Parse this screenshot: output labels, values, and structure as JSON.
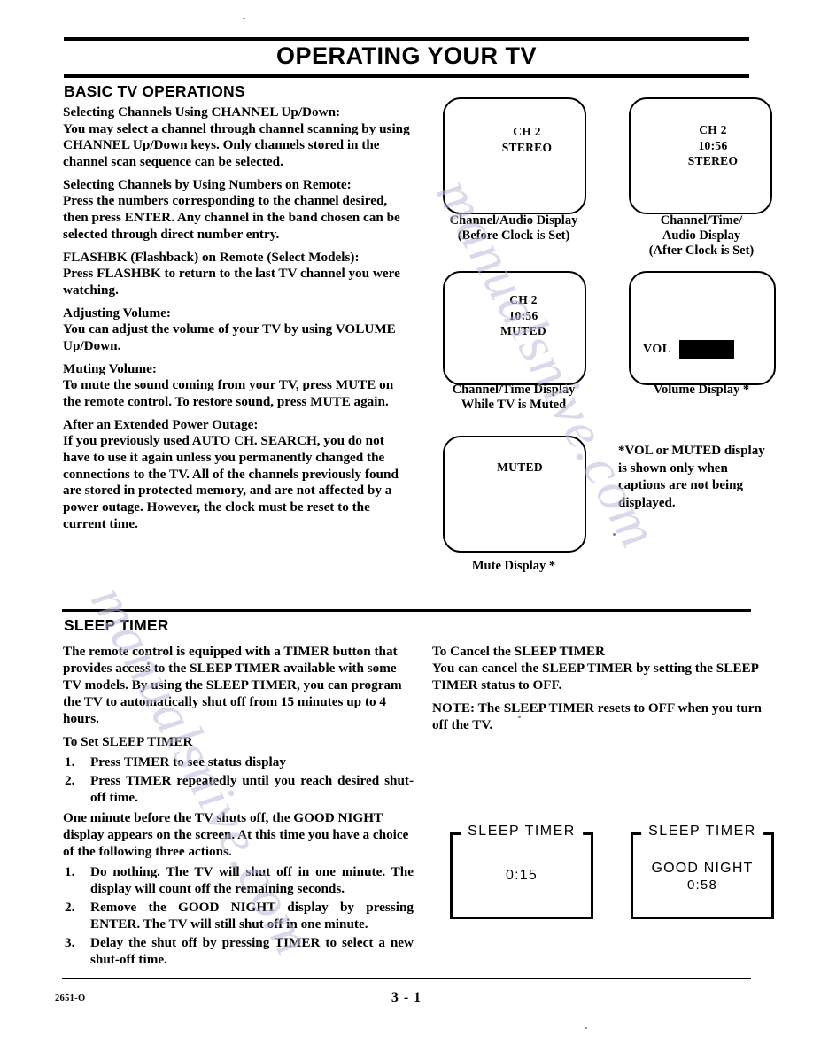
{
  "document": {
    "title": "OPERATING YOUR TV",
    "footer_code": "2651-O",
    "page_number": "3 - 1",
    "watermark": "manualsnive.com"
  },
  "basic_operations": {
    "heading": "BASIC TV OPERATIONS",
    "blocks": [
      {
        "heading": "Selecting Channels Using CHANNEL Up/Down:",
        "body": "You may select a channel through channel scanning by using CHANNEL Up/Down keys. Only channels stored in the channel scan sequence can be selected."
      },
      {
        "heading": "Selecting Channels by Using Numbers on Remote:",
        "body": "Press the numbers corresponding to the channel desired, then press ENTER. Any channel in the band chosen can be selected through direct number entry."
      },
      {
        "heading": "FLASHBK (Flashback) on Remote (Select Models):",
        "body": "Press FLASHBK to return to the last TV channel you were watching."
      },
      {
        "heading": "Adjusting Volume:",
        "body": "You can adjust the volume of your TV by using VOLUME Up/Down."
      },
      {
        "heading": "Muting Volume:",
        "body": "To mute the sound coming from your TV, press MUTE on the remote control. To restore sound, press MUTE again."
      },
      {
        "heading": "After an Extended Power Outage:",
        "body": "If you previously used AUTO CH. SEARCH, you do not have to use it again unless you permanently changed the connections to the TV. All of the channels previously found are stored in protected memory, and are not affected by a power outage.  However, the clock must be reset to the current time."
      }
    ]
  },
  "displays": {
    "channel_audio": {
      "screen_line1": "CH 2",
      "screen_line2": "STEREO",
      "caption_line1": "Channel/Audio Display",
      "caption_line2": "(Before Clock is Set)"
    },
    "channel_time_audio": {
      "screen_line1": "CH 2",
      "screen_line2": "10:56",
      "screen_line3": "STEREO",
      "caption_line1": "Channel/Time/",
      "caption_line2": "Audio Display",
      "caption_line3": "(After Clock is Set)"
    },
    "channel_time_muted": {
      "screen_line1": "CH 2",
      "screen_line2": "10:56",
      "screen_line3": "MUTED",
      "caption_line1": "Channel/Time Display",
      "caption_line2": "While TV is Muted"
    },
    "volume": {
      "label": "VOL",
      "caption": "Volume Display *"
    },
    "mute": {
      "screen_line1": "MUTED",
      "caption": "Mute Display *"
    },
    "footnote": "*VOL or MUTED display is shown only when captions are not being displayed."
  },
  "sleep_timer": {
    "heading": "SLEEP TIMER",
    "intro": "The remote control is equipped with a TIMER button that provides access to the SLEEP TIMER available with some TV models.  By using the SLEEP TIMER, you can program the TV to automatically shut off from 15 minutes up to 4 hours.",
    "set_heading": "To Set SLEEP TIMER",
    "set_steps": [
      {
        "num": "1.",
        "text": "Press TIMER to see status display"
      },
      {
        "num": "2.",
        "text": "Press TIMER repeatedly until you reach desired shut-off time."
      }
    ],
    "good_night_intro": "One minute before the TV shuts off, the GOOD NIGHT display appears on the screen. At this time you have a choice of the following three actions.",
    "action_steps": [
      {
        "num": "1.",
        "text": "Do nothing. The TV will shut off in one minute. The display will count off the remaining seconds."
      },
      {
        "num": "2.",
        "text": "Remove the GOOD NIGHT display by pressing ENTER. The TV will still shut off in one minute."
      },
      {
        "num": "3.",
        "text": "Delay the shut off by pressing TIMER to select a new shut-off time."
      }
    ],
    "cancel_heading": "To Cancel the SLEEP TIMER",
    "cancel_body": "You can cancel the SLEEP TIMER by setting the SLEEP TIMER status to OFF.",
    "note": "NOTE:  The SLEEP TIMER resets to OFF when you turn off the TV.",
    "screens": [
      {
        "legend": "SLEEP TIMER",
        "line1": "0:15",
        "line2": ""
      },
      {
        "legend": "SLEEP TIMER",
        "line1": "GOOD NIGHT",
        "line2": "0:58"
      }
    ]
  }
}
